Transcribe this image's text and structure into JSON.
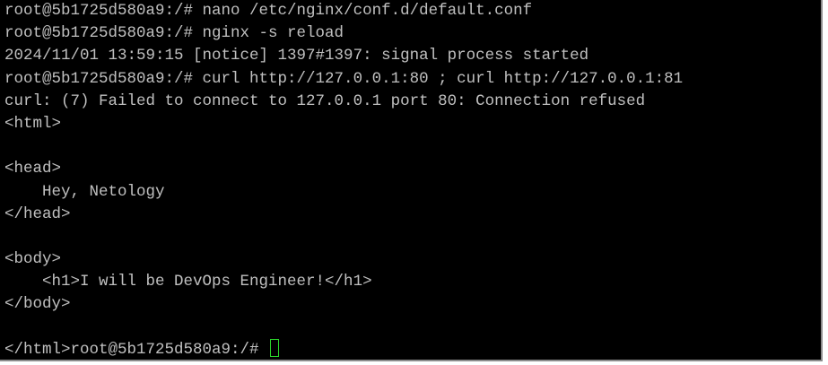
{
  "terminal": {
    "lines": [
      "root@5b1725d580a9:/# nano /etc/nginx/conf.d/default.conf",
      "root@5b1725d580a9:/# nginx -s reload",
      "2024/11/01 13:59:15 [notice] 1397#1397: signal process started",
      "root@5b1725d580a9:/# curl http://127.0.0.1:80 ; curl http://127.0.0.1:81",
      "curl: (7) Failed to connect to 127.0.0.1 port 80: Connection refused",
      "<html>",
      "",
      "<head>",
      "    Hey, Netology",
      "</head>",
      "",
      "<body>",
      "    <h1>I will be DevOps Engineer!</h1>",
      "</body>",
      ""
    ],
    "final_prompt": "</html>root@5b1725d580a9:/# ",
    "colors": {
      "background": "#000000",
      "text": "#c0c0c0",
      "cursor": "#2bd62b"
    }
  }
}
